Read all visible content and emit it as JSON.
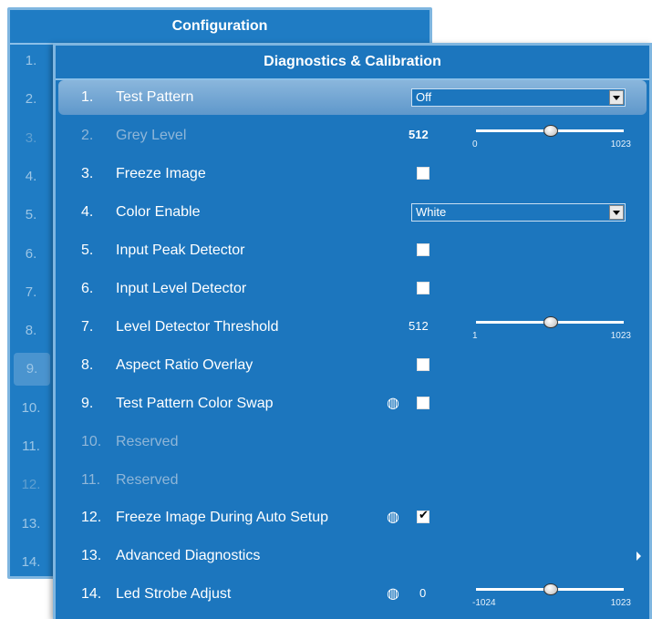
{
  "back_window": {
    "title": "Configuration",
    "rows": [
      "1.",
      "2.",
      "3.",
      "4.",
      "5.",
      "6.",
      "7.",
      "8.",
      "9.",
      "10.",
      "11.",
      "12.",
      "13.",
      "14."
    ]
  },
  "front_window": {
    "title": "Diagnostics & Calibration",
    "rows": [
      {
        "num": "1.",
        "label": "Test Pattern",
        "control": "select",
        "value": "Off"
      },
      {
        "num": "2.",
        "label": "Grey Level",
        "control": "slider",
        "value": "512",
        "min": "0",
        "max": "1023",
        "position": 0.5
      },
      {
        "num": "3.",
        "label": "Freeze Image",
        "control": "checkbox",
        "checked": false
      },
      {
        "num": "4.",
        "label": "Color Enable",
        "control": "select",
        "value": "White"
      },
      {
        "num": "5.",
        "label": "Input Peak Detector",
        "control": "checkbox",
        "checked": false
      },
      {
        "num": "6.",
        "label": "Input Level Detector",
        "control": "checkbox",
        "checked": false
      },
      {
        "num": "7.",
        "label": "Level Detector Threshold",
        "control": "slider",
        "value": "512",
        "min": "1",
        "max": "1023",
        "position": 0.5
      },
      {
        "num": "8.",
        "label": "Aspect Ratio Overlay",
        "control": "checkbox",
        "checked": false
      },
      {
        "num": "9.",
        "label": "Test Pattern Color Swap",
        "control": "checkbox",
        "checked": false,
        "globe": true
      },
      {
        "num": "10.",
        "label": "Reserved",
        "control": "none"
      },
      {
        "num": "11.",
        "label": "Reserved",
        "control": "none"
      },
      {
        "num": "12.",
        "label": "Freeze Image During Auto Setup",
        "control": "checkbox",
        "checked": true,
        "globe": true
      },
      {
        "num": "13.",
        "label": "Advanced Diagnostics",
        "control": "submenu"
      },
      {
        "num": "14.",
        "label": "Led Strobe Adjust",
        "control": "slider",
        "value": "0",
        "min": "-1024",
        "max": "1023",
        "position": 0.5,
        "globe": true
      }
    ]
  },
  "icons": {
    "globe": "globe-icon",
    "submenu": "chevron-right-icon",
    "dropdown": "dropdown-arrow-icon"
  },
  "colors": {
    "panel_bg": "#1c76be",
    "border": "#7fb6e0",
    "selected_row": "#7aaad6",
    "disabled_text": "#8fb6d8"
  }
}
